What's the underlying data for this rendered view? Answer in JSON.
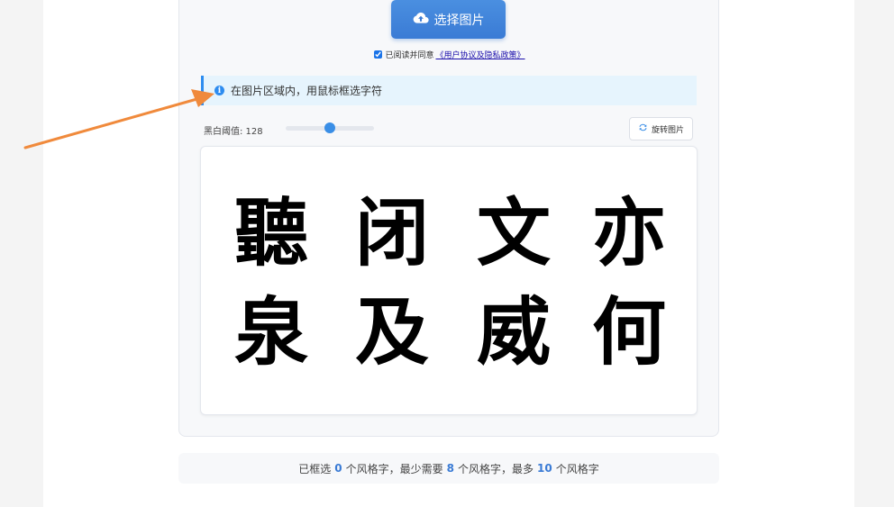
{
  "upload": {
    "label": "选择图片",
    "icon": "cloud-upload-icon"
  },
  "agreement": {
    "prefix": "已阅读并同意",
    "link": "《用户协议及隐私政策》",
    "checked": true
  },
  "info": {
    "text": "在图片区域内，用鼠标框选字符",
    "icon": "info-icon"
  },
  "threshold": {
    "label": "黑白阈值: 128",
    "value": 128,
    "min": 0,
    "max": 255
  },
  "rotate": {
    "label": "旋转图片",
    "icon": "rotate-icon"
  },
  "characters": [
    "聽",
    "闭",
    "文",
    "亦",
    "泉",
    "及",
    "威",
    "何"
  ],
  "stats": {
    "part1": "已框选",
    "selected": "0",
    "part2": "个风格字，最少需要",
    "min": "8",
    "part3": "个风格字，最多",
    "max": "10",
    "part4": "个风格字"
  },
  "colors": {
    "accent": "#3a7bd5",
    "annotation_arrow": "#f08a3c"
  }
}
